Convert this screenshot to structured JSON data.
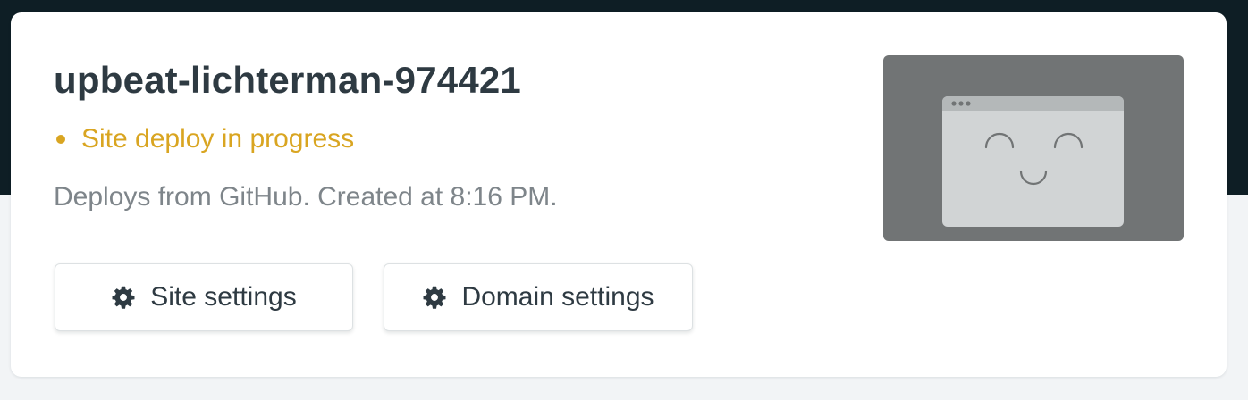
{
  "site": {
    "name": "upbeat-lichterman-974421",
    "status": "Site deploy in progress",
    "meta_prefix": "Deploys from ",
    "provider": "GitHub",
    "meta_suffix": ". Created at 8:16 PM."
  },
  "actions": {
    "site_settings_label": "Site settings",
    "domain_settings_label": "Domain settings"
  },
  "icons": {
    "status": "status-dot-icon",
    "settings": "gear-icon",
    "preview": "browser-window-smiley-icon"
  },
  "colors": {
    "background_dark": "#0e1e25",
    "page_background": "#f2f4f6",
    "title": "#2e3a42",
    "status_pending": "#d9a521",
    "muted_text": "#7e858a",
    "preview_background": "#717475",
    "preview_window": "#d1d4d5"
  }
}
